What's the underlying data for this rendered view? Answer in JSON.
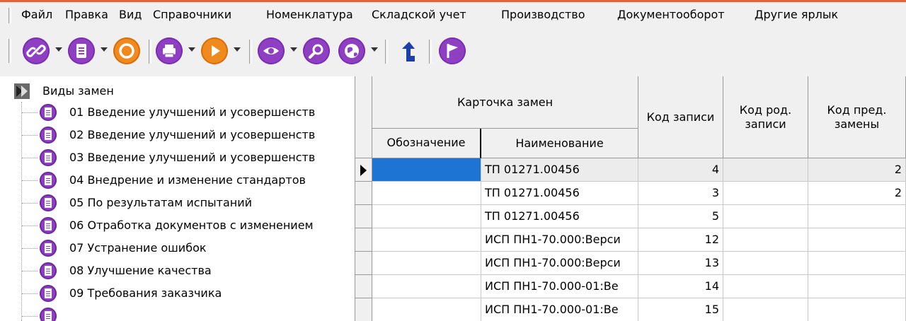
{
  "menu": {
    "items": [
      "Файл",
      "Правка",
      "Вид",
      "Справочники",
      "Номенклатура",
      "Складской учет",
      "Производство",
      "Документооборот",
      "Другие ярлык"
    ]
  },
  "toolbar": {
    "buttons": [
      "link-icon",
      "document-icon",
      "refresh-icon",
      "print-icon",
      "play-icon",
      "eye-icon",
      "search-icon",
      "globe-icon",
      "jump-arrow-icon",
      "flag-icon"
    ],
    "accent": "#8f3fc2"
  },
  "tree": {
    "root_label": "Виды замен",
    "items": [
      "01 Введение улучшений и усовершенств",
      "02 Введение улучшений и усовершенств",
      "03 Введение улучшений и усовершенств",
      "04 Внедрение и изменение стандартов",
      "05 По результатам испытаний",
      "06 Отработка документов с изменением",
      "07 Устранение ошибок",
      "08 Улучшение качества",
      "09 Требования заказчика"
    ]
  },
  "grid": {
    "group_header": "Карточка замен",
    "columns": {
      "designation": "Обозначение",
      "name": "Наименование",
      "record_code": "Код записи",
      "parent_code_1": "Код род.",
      "parent_code_2": "записи",
      "prev_code_1": "Код пред.",
      "prev_code_2": "замены"
    },
    "rows": [
      {
        "designation": "",
        "name": "ТП 01271.00456",
        "record_code": "4",
        "parent_code": "",
        "prev_code": "2"
      },
      {
        "designation": "",
        "name": "ТП 01271.00456",
        "record_code": "3",
        "parent_code": "",
        "prev_code": "2"
      },
      {
        "designation": "",
        "name": "ТП 01271.00456",
        "record_code": "5",
        "parent_code": "",
        "prev_code": ""
      },
      {
        "designation": "",
        "name": "ИСП ПН1-70.000:Верси",
        "record_code": "12",
        "parent_code": "",
        "prev_code": ""
      },
      {
        "designation": "",
        "name": "ИСП ПН1-70.000:Верси",
        "record_code": "13",
        "parent_code": "",
        "prev_code": ""
      },
      {
        "designation": "",
        "name": "ИСП ПН1-70.000-01:Ве",
        "record_code": "14",
        "parent_code": "",
        "prev_code": ""
      },
      {
        "designation": "",
        "name": "ИСП ПН1-70.000-01:Ве",
        "record_code": "15",
        "parent_code": "",
        "prev_code": ""
      }
    ],
    "selected_color": "#1e74d2"
  }
}
